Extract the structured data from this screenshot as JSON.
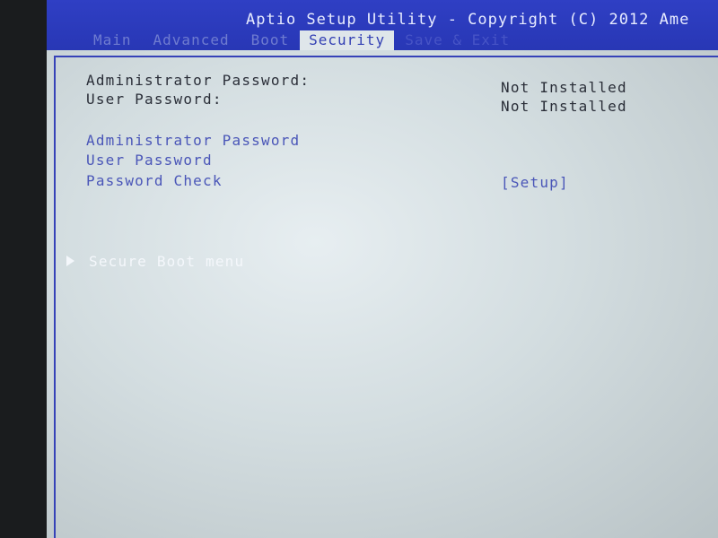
{
  "header": {
    "title": "Aptio Setup Utility - Copyright (C) 2012 Ame",
    "tabs": [
      {
        "label": "Main"
      },
      {
        "label": "Advanced"
      },
      {
        "label": "Boot"
      },
      {
        "label": "Security"
      },
      {
        "label": "Save & Exit"
      }
    ],
    "active_tab": "Security"
  },
  "security": {
    "admin_password_status_label": "Administrator Password:",
    "admin_password_status_value": "Not Installed",
    "user_password_status_label": "User Password:",
    "user_password_status_value": "Not Installed",
    "admin_password_item": "Administrator Password",
    "user_password_item": "User Password",
    "password_check_label": "Password Check",
    "password_check_value": "[Setup]",
    "secure_boot_menu": "Secure Boot menu"
  },
  "colors": {
    "header_bg": "#2f3fc4",
    "link_text": "#4a56b8",
    "static_text": "#2a2e38",
    "selected_text": "#f4f7fb"
  }
}
